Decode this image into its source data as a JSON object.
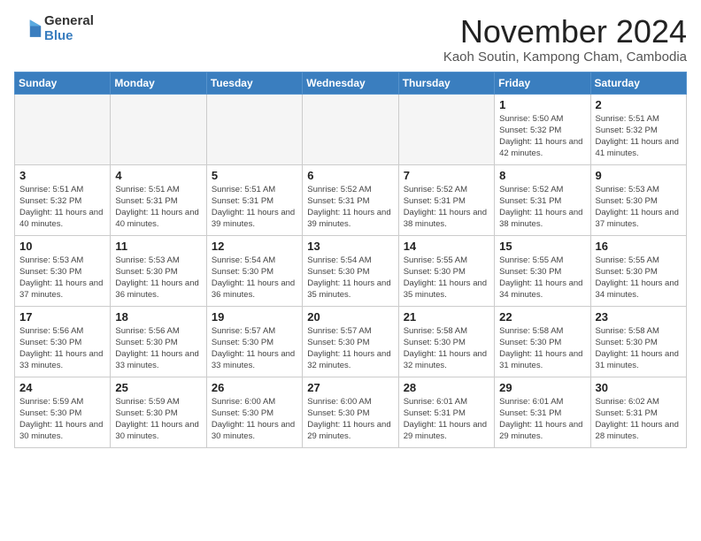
{
  "header": {
    "logo_general": "General",
    "logo_blue": "Blue",
    "month_title": "November 2024",
    "location": "Kaoh Soutin, Kampong Cham, Cambodia"
  },
  "weekdays": [
    "Sunday",
    "Monday",
    "Tuesday",
    "Wednesday",
    "Thursday",
    "Friday",
    "Saturday"
  ],
  "weeks": [
    [
      {
        "day": "",
        "empty": true
      },
      {
        "day": "",
        "empty": true
      },
      {
        "day": "",
        "empty": true
      },
      {
        "day": "",
        "empty": true
      },
      {
        "day": "",
        "empty": true
      },
      {
        "day": "1",
        "sunrise": "5:50 AM",
        "sunset": "5:32 PM",
        "daylight": "11 hours and 42 minutes."
      },
      {
        "day": "2",
        "sunrise": "5:51 AM",
        "sunset": "5:32 PM",
        "daylight": "11 hours and 41 minutes."
      }
    ],
    [
      {
        "day": "3",
        "sunrise": "5:51 AM",
        "sunset": "5:32 PM",
        "daylight": "11 hours and 40 minutes."
      },
      {
        "day": "4",
        "sunrise": "5:51 AM",
        "sunset": "5:31 PM",
        "daylight": "11 hours and 40 minutes."
      },
      {
        "day": "5",
        "sunrise": "5:51 AM",
        "sunset": "5:31 PM",
        "daylight": "11 hours and 39 minutes."
      },
      {
        "day": "6",
        "sunrise": "5:52 AM",
        "sunset": "5:31 PM",
        "daylight": "11 hours and 39 minutes."
      },
      {
        "day": "7",
        "sunrise": "5:52 AM",
        "sunset": "5:31 PM",
        "daylight": "11 hours and 38 minutes."
      },
      {
        "day": "8",
        "sunrise": "5:52 AM",
        "sunset": "5:31 PM",
        "daylight": "11 hours and 38 minutes."
      },
      {
        "day": "9",
        "sunrise": "5:53 AM",
        "sunset": "5:30 PM",
        "daylight": "11 hours and 37 minutes."
      }
    ],
    [
      {
        "day": "10",
        "sunrise": "5:53 AM",
        "sunset": "5:30 PM",
        "daylight": "11 hours and 37 minutes."
      },
      {
        "day": "11",
        "sunrise": "5:53 AM",
        "sunset": "5:30 PM",
        "daylight": "11 hours and 36 minutes."
      },
      {
        "day": "12",
        "sunrise": "5:54 AM",
        "sunset": "5:30 PM",
        "daylight": "11 hours and 36 minutes."
      },
      {
        "day": "13",
        "sunrise": "5:54 AM",
        "sunset": "5:30 PM",
        "daylight": "11 hours and 35 minutes."
      },
      {
        "day": "14",
        "sunrise": "5:55 AM",
        "sunset": "5:30 PM",
        "daylight": "11 hours and 35 minutes."
      },
      {
        "day": "15",
        "sunrise": "5:55 AM",
        "sunset": "5:30 PM",
        "daylight": "11 hours and 34 minutes."
      },
      {
        "day": "16",
        "sunrise": "5:55 AM",
        "sunset": "5:30 PM",
        "daylight": "11 hours and 34 minutes."
      }
    ],
    [
      {
        "day": "17",
        "sunrise": "5:56 AM",
        "sunset": "5:30 PM",
        "daylight": "11 hours and 33 minutes."
      },
      {
        "day": "18",
        "sunrise": "5:56 AM",
        "sunset": "5:30 PM",
        "daylight": "11 hours and 33 minutes."
      },
      {
        "day": "19",
        "sunrise": "5:57 AM",
        "sunset": "5:30 PM",
        "daylight": "11 hours and 33 minutes."
      },
      {
        "day": "20",
        "sunrise": "5:57 AM",
        "sunset": "5:30 PM",
        "daylight": "11 hours and 32 minutes."
      },
      {
        "day": "21",
        "sunrise": "5:58 AM",
        "sunset": "5:30 PM",
        "daylight": "11 hours and 32 minutes."
      },
      {
        "day": "22",
        "sunrise": "5:58 AM",
        "sunset": "5:30 PM",
        "daylight": "11 hours and 31 minutes."
      },
      {
        "day": "23",
        "sunrise": "5:58 AM",
        "sunset": "5:30 PM",
        "daylight": "11 hours and 31 minutes."
      }
    ],
    [
      {
        "day": "24",
        "sunrise": "5:59 AM",
        "sunset": "5:30 PM",
        "daylight": "11 hours and 30 minutes."
      },
      {
        "day": "25",
        "sunrise": "5:59 AM",
        "sunset": "5:30 PM",
        "daylight": "11 hours and 30 minutes."
      },
      {
        "day": "26",
        "sunrise": "6:00 AM",
        "sunset": "5:30 PM",
        "daylight": "11 hours and 30 minutes."
      },
      {
        "day": "27",
        "sunrise": "6:00 AM",
        "sunset": "5:30 PM",
        "daylight": "11 hours and 29 minutes."
      },
      {
        "day": "28",
        "sunrise": "6:01 AM",
        "sunset": "5:31 PM",
        "daylight": "11 hours and 29 minutes."
      },
      {
        "day": "29",
        "sunrise": "6:01 AM",
        "sunset": "5:31 PM",
        "daylight": "11 hours and 29 minutes."
      },
      {
        "day": "30",
        "sunrise": "6:02 AM",
        "sunset": "5:31 PM",
        "daylight": "11 hours and 28 minutes."
      }
    ]
  ],
  "labels": {
    "sunrise": "Sunrise:",
    "sunset": "Sunset:",
    "daylight": "Daylight:"
  }
}
